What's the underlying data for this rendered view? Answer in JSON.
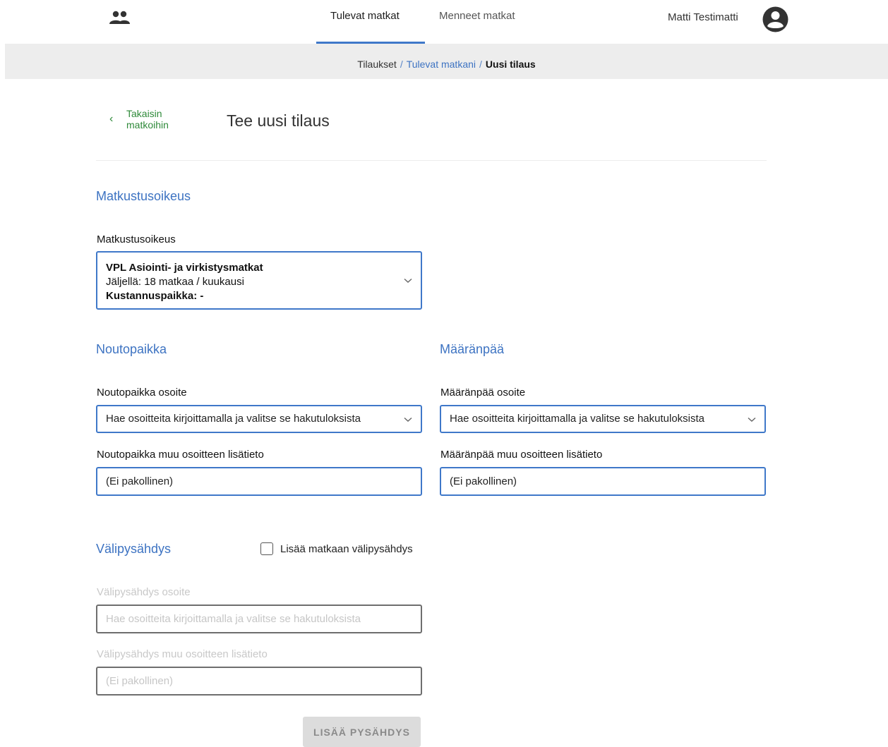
{
  "header": {
    "tabs": [
      {
        "label": "Tulevat matkat",
        "active": true
      },
      {
        "label": "Menneet matkat",
        "active": false
      }
    ],
    "user_name": "Matti Testimatti",
    "logo_icon": "group-icon",
    "avatar_icon": "account-circle-icon",
    "accent_color": "#3f78c9"
  },
  "breadcrumb": {
    "home": "Tilaukset",
    "separator": "/",
    "parent": "Tulevat matkani",
    "current": "Uusi tilaus"
  },
  "page": {
    "back_line1": "Takaisin",
    "back_line2": "matkoihin",
    "title": "Tee uusi tilaus"
  },
  "entitlement": {
    "section_title": "Matkustusoikeus",
    "label": "Matkustusoikeus",
    "selected_name": "VPL Asiointi- ja virkistysmatkat",
    "remaining": "Jäljellä: 18 matkaa / kuukausi",
    "cost_center": "Kustannuspaikka: -"
  },
  "pickup": {
    "section_title": "Noutopaikka",
    "address_label": "Noutopaikka osoite",
    "address_placeholder": "Hae osoitteita kirjoittamalla ja valitse se hakutuloksista",
    "extra_label": "Noutopaikka muu osoitteen lisätieto",
    "extra_placeholder": "(Ei pakollinen)"
  },
  "destination": {
    "section_title": "Määränpää",
    "address_label": "Määränpää osoite",
    "address_placeholder": "Hae osoitteita kirjoittamalla ja valitse se hakutuloksista",
    "extra_label": "Määränpää muu osoitteen lisätieto",
    "extra_placeholder": "(Ei pakollinen)"
  },
  "stopover": {
    "section_title": "Välipysähdys",
    "checkbox_label": "Lisää matkaan välipysähdys",
    "checkbox_checked": false,
    "address_label": "Välipysähdys osoite",
    "address_placeholder": "Hae osoitteita kirjoittamalla ja valitse se hakutuloksista",
    "extra_label": "Välipysähdys muu osoitteen lisätieto",
    "extra_placeholder": "(Ei pakollinen)",
    "add_button": "LISÄÄ PYSÄHDYS"
  }
}
